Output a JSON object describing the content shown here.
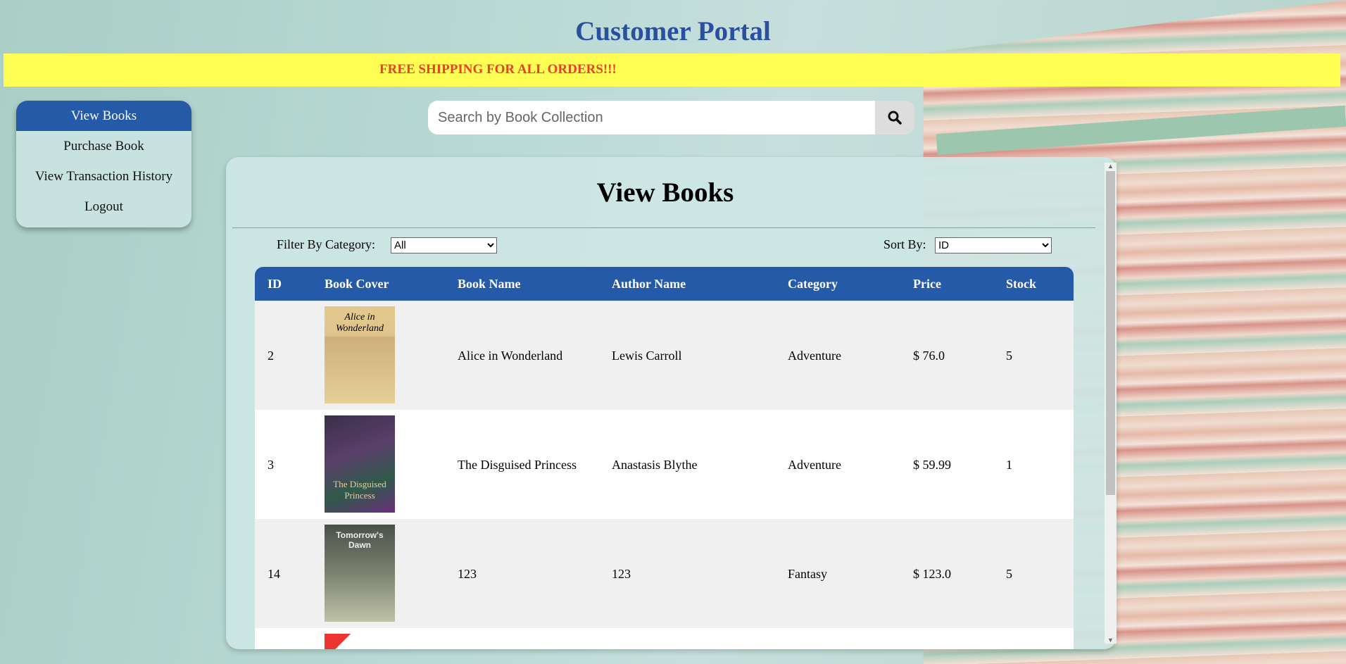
{
  "header": {
    "title": "Customer Portal",
    "banner": "FREE SHIPPING FOR ALL ORDERS!!!"
  },
  "sidebar": {
    "items": [
      {
        "label": "View Books",
        "active": true
      },
      {
        "label": "Purchase Book"
      },
      {
        "label": "View Transaction History"
      },
      {
        "label": "Logout"
      }
    ]
  },
  "search": {
    "placeholder": "Search by Book Collection",
    "icon": "search-icon"
  },
  "panel": {
    "title": "View Books",
    "filter_label": "Filter By Category:",
    "filter_value": "All",
    "sort_label": "Sort By:",
    "sort_value": "ID"
  },
  "table": {
    "headers": [
      "ID",
      "Book Cover",
      "Book Name",
      "Author Name",
      "Category",
      "Price",
      "Stock"
    ],
    "rows": [
      {
        "id": "2",
        "cover_text": "Alice in Wonderland",
        "name": "Alice in Wonderland",
        "author": "Lewis Carroll",
        "category": "Adventure",
        "price": "$ 76.0",
        "stock": "5"
      },
      {
        "id": "3",
        "cover_text": "The Disguised Princess",
        "name": "The Disguised Princess",
        "author": "Anastasis Blythe",
        "category": "Adventure",
        "price": "$ 59.99",
        "stock": "1"
      },
      {
        "id": "14",
        "cover_text": "Tomorrow's Dawn",
        "name": "123",
        "author": "123",
        "category": "Fantasy",
        "price": "$ 123.0",
        "stock": "5"
      }
    ]
  },
  "colors": {
    "accent": "#255aa8",
    "banner_bg": "#ffff55",
    "banner_text": "#e8402a",
    "title": "#2a4fa0"
  }
}
